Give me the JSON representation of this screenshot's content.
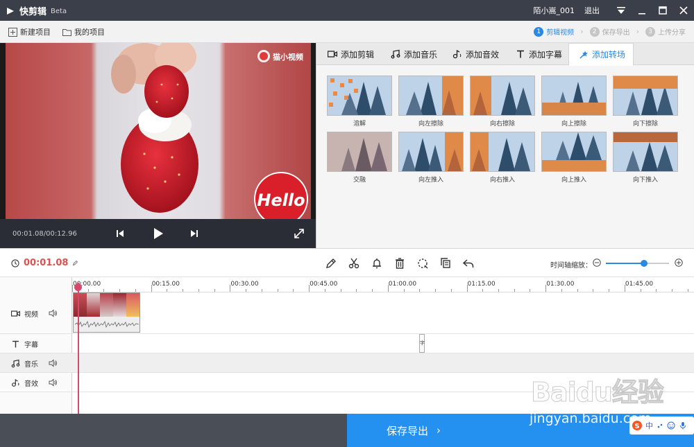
{
  "titlebar": {
    "app_name": "快剪辑",
    "beta": "Beta",
    "username": "陌小嵩_001",
    "logout": "退出"
  },
  "toolbar": {
    "new_project": "新建项目",
    "my_projects": "我的项目",
    "steps": [
      {
        "num": "1",
        "label": "剪辑视频",
        "active": true
      },
      {
        "num": "2",
        "label": "保存导出",
        "active": false
      },
      {
        "num": "3",
        "label": "上传分享",
        "active": false
      }
    ]
  },
  "preview": {
    "watermark_text": "猫小视频",
    "sticker_text": "Hello",
    "time": "00:01.08/00:12.96"
  },
  "tabs": [
    {
      "label": "添加剪辑",
      "icon": "video-icon"
    },
    {
      "label": "添加音乐",
      "icon": "music-icon"
    },
    {
      "label": "添加音效",
      "icon": "sound-effect-icon"
    },
    {
      "label": "添加字幕",
      "icon": "text-icon"
    },
    {
      "label": "添加转场",
      "icon": "transition-icon",
      "active": true
    }
  ],
  "transitions": [
    {
      "label": "溶解"
    },
    {
      "label": "向左擦除"
    },
    {
      "label": "向右擦除"
    },
    {
      "label": "向上擦除"
    },
    {
      "label": "向下擦除"
    },
    {
      "label": "交融"
    },
    {
      "label": "向左推入"
    },
    {
      "label": "向右推入"
    },
    {
      "label": "向上推入"
    },
    {
      "label": "向下推入"
    }
  ],
  "timeline_bar": {
    "current_time": "00:01.08",
    "zoom_label": "时间轴缩放：",
    "zoom_level": 0.6
  },
  "ruler": [
    "00:00.00",
    "00:15.00",
    "00:30.00",
    "00:45.00",
    "01:00.00",
    "01:15.00",
    "01:30.00",
    "01:45.00"
  ],
  "tracks": {
    "video": "视频",
    "subtitle": "字幕",
    "music": "音乐",
    "sfx": "音效"
  },
  "subtitle_marker": "字",
  "export": {
    "label": "保存导出",
    "arrow": "›"
  },
  "watermark": {
    "logo": "Baidu经验",
    "url": "jingyan.baidu.com"
  },
  "ime": {
    "text": "中"
  },
  "colors": {
    "accent": "#2a8ae0",
    "time_red": "#d9534f",
    "playhead": "#d9486a",
    "titlebar": "#3a3f4a"
  }
}
